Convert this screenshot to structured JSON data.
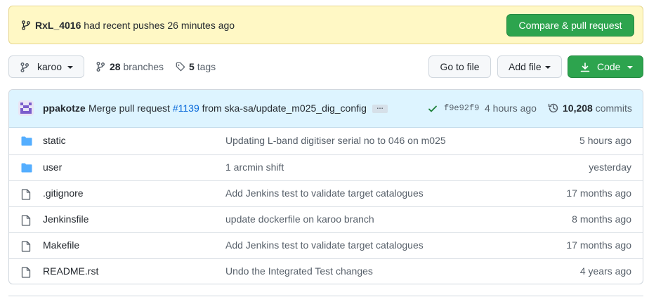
{
  "banner": {
    "branch": "RxL_4016",
    "text": "had recent pushes 26 minutes ago",
    "compare_button": "Compare & pull request"
  },
  "toolbar": {
    "branch": "karoo",
    "branches_count": "28",
    "branches_label": "branches",
    "tags_count": "5",
    "tags_label": "tags",
    "goto_file": "Go to file",
    "add_file": "Add file",
    "code": "Code"
  },
  "commit": {
    "author": "ppakotze",
    "message_pre": "Merge pull request",
    "pr": "#1139",
    "message_post": "from ska-sa/update_m025_dig_config",
    "ellipsis": "…",
    "sha": "f9e92f9",
    "time": "4 hours ago",
    "count": "10,208",
    "count_label": "commits"
  },
  "files": [
    {
      "type": "folder",
      "name": "static",
      "message": "Updating L-band digitiser serial no to 046 on m025",
      "time": "5 hours ago"
    },
    {
      "type": "folder",
      "name": "user",
      "message": "1 arcmin shift",
      "time": "yesterday"
    },
    {
      "type": "file",
      "name": ".gitignore",
      "message": "Add Jenkins test to validate target catalogues",
      "time": "17 months ago"
    },
    {
      "type": "file",
      "name": "Jenkinsfile",
      "message": "update dockerfile on karoo branch",
      "time": "8 months ago"
    },
    {
      "type": "file",
      "name": "Makefile",
      "message": "Add Jenkins test to validate target catalogues",
      "time": "17 months ago"
    },
    {
      "type": "file",
      "name": "README.rst",
      "message": "Undo the Integrated Test changes",
      "time": "4 years ago"
    }
  ],
  "colors": {
    "accent_green": "#2da44e",
    "link_blue": "#0969da",
    "folder_blue": "#54aeff",
    "banner_bg": "#fff8c5",
    "commit_bar_bg": "#ddf4ff"
  }
}
